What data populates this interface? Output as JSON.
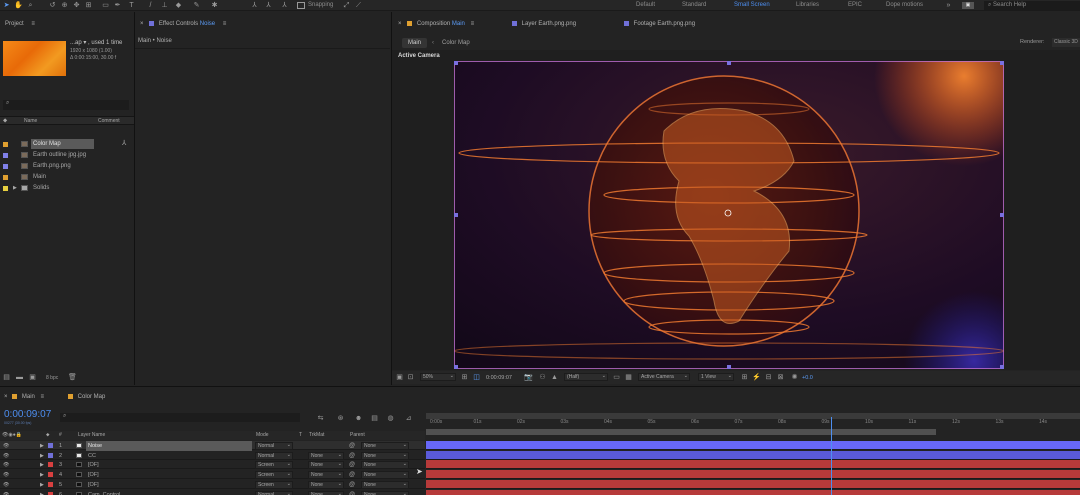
{
  "toolbar": {
    "snapping_label": "Snapping",
    "workspaces": [
      "Default",
      "Standard",
      "Small Screen",
      "Libraries",
      "EPIC",
      "Dope motions"
    ],
    "active_workspace": "Small Screen",
    "search_placeholder": "Search Help"
  },
  "project": {
    "title": "Project",
    "thumb_name": "...ap",
    "thumb_used": ", used 1 time",
    "thumb_info1": "1920 x 1080 (1.00)",
    "thumb_info2": "Δ 0:00:15:00, 30.00 f",
    "search_placeholder": "",
    "col_name": "Name",
    "col_comment": "Comment",
    "items": [
      {
        "name": "Color Map",
        "color": "#e0a030",
        "selected": true
      },
      {
        "name": "Earth outline jpg.jpg",
        "color": "#8080e8"
      },
      {
        "name": "Earth.png.png",
        "color": "#8080e8"
      },
      {
        "name": "Main",
        "color": "#e0a030"
      },
      {
        "name": "Solids",
        "color": "#e8d040"
      }
    ],
    "bpc": "8 bpc"
  },
  "effect_controls": {
    "title": "Effect Controls",
    "layer": "Noise",
    "breadcrumb": "Main • Noise"
  },
  "composition": {
    "tab_title": "Composition",
    "tab_comp": "Main",
    "tab_layer": "Layer  Earth.png.png",
    "tab_footage": "Footage  Earth.png.png",
    "subtab_main": "Main",
    "subtab_colormap": "Color Map",
    "renderer_label": "Renderer:",
    "renderer_value": "Classic 3D",
    "active_camera": "Active Camera",
    "zoom": "50%",
    "timecode": "0:00:09:07",
    "resolution": "(Half)",
    "camera_dd": "Active Camera",
    "view_dd": "1 View",
    "exposure": "+0.0"
  },
  "timeline": {
    "tab_main": "Main",
    "tab_colormap": "Color Map",
    "timecode": "0:00:09:07",
    "fps_info": "00277 (30.00 fps)",
    "search_placeholder": "",
    "col_num": "#",
    "col_layer": "Layer Name",
    "col_mode": "Mode",
    "col_t": "T",
    "col_trkmat": "TrkMat",
    "col_parent": "Parent",
    "layers": [
      {
        "num": "1",
        "name": "Noise",
        "color": "#7070d8",
        "mode": "Normal",
        "trkmat": "",
        "parent": "None",
        "selected": true
      },
      {
        "num": "2",
        "name": "CC",
        "color": "#7070d8",
        "mode": "Normal",
        "trkmat": "None",
        "parent": "None"
      },
      {
        "num": "3",
        "name": "[OF]",
        "color": "#d84040",
        "mode": "Screen",
        "trkmat": "None",
        "parent": "None"
      },
      {
        "num": "4",
        "name": "[OF]",
        "color": "#d84040",
        "mode": "Screen",
        "trkmat": "None",
        "parent": "None"
      },
      {
        "num": "5",
        "name": "[OF]",
        "color": "#d84040",
        "mode": "Screen",
        "trkmat": "None",
        "parent": "None"
      },
      {
        "num": "6",
        "name": "Cam_Control",
        "color": "#d84040",
        "mode": "Normal",
        "trkmat": "None",
        "parent": "None"
      }
    ],
    "ruler": [
      "0:00s",
      "01s",
      "02s",
      "03s",
      "04s",
      "05s",
      "06s",
      "07s",
      "08s",
      "09s",
      "10s",
      "11s",
      "12s",
      "13s",
      "14s"
    ],
    "playhead_fraction": 0.62
  },
  "colors": {
    "accent_blue": "#4d8ef0",
    "layer_blue": "#5a5ad8",
    "layer_red": "#b63a3a",
    "thumb_orange": "#f07a10"
  }
}
